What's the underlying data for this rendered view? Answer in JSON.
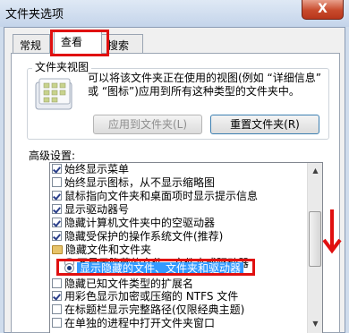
{
  "window": {
    "title": "文件夹选项",
    "close_label": "X"
  },
  "tabs": [
    {
      "label": "常规"
    },
    {
      "label": "查看"
    },
    {
      "label": "搜索"
    }
  ],
  "folder_view": {
    "group_label": "文件夹视图",
    "description": "可以将该文件夹正在使用的视图(例如 “详细信息” 或 “图标”)应用到所有这种类型的文件夹中。",
    "apply_button": "应用到文件夹(L)",
    "reset_button": "重置文件夹(R)"
  },
  "advanced": {
    "label": "高级设置:",
    "items": [
      {
        "text": "始终显示菜单",
        "kind": "checkbox",
        "checked": true
      },
      {
        "text": "始终显示图标，从不显示缩略图",
        "kind": "checkbox",
        "checked": false
      },
      {
        "text": "鼠标指向文件夹和桌面项时显示提示信息",
        "kind": "checkbox",
        "checked": true
      },
      {
        "text": "显示驱动器号",
        "kind": "checkbox",
        "checked": true
      },
      {
        "text": "隐藏计算机文件夹中的空驱动器",
        "kind": "checkbox",
        "checked": true
      },
      {
        "text": "隐藏受保护的操作系统文件(推荐)",
        "kind": "checkbox",
        "checked": true
      },
      {
        "text": "隐藏文件和文件夹",
        "kind": "folder"
      },
      {
        "text": "不显示隐藏的文件、文件夹或驱动器",
        "kind": "radio",
        "checked": false
      },
      {
        "text": "显示隐藏的文件、文件夹和驱动器",
        "kind": "radio",
        "checked": true
      },
      {
        "text": "隐藏已知文件类型的扩展名",
        "kind": "checkbox",
        "checked": false
      },
      {
        "text": "用彩色显示加密或压缩的 NTFS 文件",
        "kind": "checkbox",
        "checked": true
      },
      {
        "text": "在标题栏显示完整路径(仅限经典主题)",
        "kind": "checkbox",
        "checked": false
      },
      {
        "text": "在单独的进程中打开文件夹窗口",
        "kind": "checkbox",
        "checked": false
      }
    ]
  },
  "colors": {
    "highlight_box": "#e01010",
    "selection": "#3399ff"
  },
  "icons": {
    "folder_view": "folder-view-icon",
    "scroll_arrow": "red-down-arrow"
  }
}
